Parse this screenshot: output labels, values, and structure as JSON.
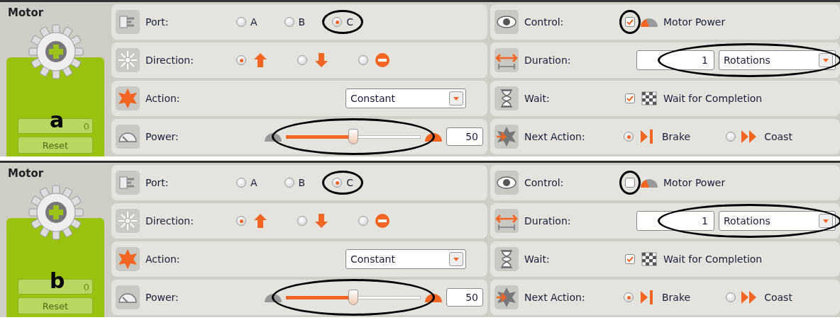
{
  "panels": [
    {
      "title": "Motor",
      "label": "a",
      "counter": "0",
      "reset": "Reset",
      "port": {
        "label": "Port:",
        "options": [
          {
            "text": "A",
            "selected": false,
            "circled": false
          },
          {
            "text": "B",
            "selected": false,
            "circled": false
          },
          {
            "text": "C",
            "selected": true,
            "circled": true
          }
        ]
      },
      "direction": {
        "label": "Direction:",
        "options": [
          {
            "kind": "forward",
            "selected": true
          },
          {
            "kind": "backward",
            "selected": false
          },
          {
            "kind": "stop",
            "selected": false
          }
        ]
      },
      "action": {
        "label": "Action:",
        "value": "Constant"
      },
      "power": {
        "label": "Power:",
        "level": 0.5,
        "value": "50",
        "circled": true
      },
      "control": {
        "label": "Control:",
        "checked": true,
        "circled": true,
        "text": "Motor Power"
      },
      "duration": {
        "label": "Duration:",
        "value": "1",
        "unit": "Rotations",
        "circled": true
      },
      "wait": {
        "label": "Wait:",
        "checked": true,
        "text": "Wait for Completion"
      },
      "next_action": {
        "label": "Next Action:",
        "options": [
          {
            "kind": "brake",
            "text": "Brake",
            "selected": true
          },
          {
            "kind": "coast",
            "text": "Coast",
            "selected": false
          }
        ]
      }
    },
    {
      "title": "Motor",
      "label": "b",
      "counter": "0",
      "reset": "Reset",
      "port": {
        "label": "Port:",
        "options": [
          {
            "text": "A",
            "selected": false,
            "circled": false
          },
          {
            "text": "B",
            "selected": false,
            "circled": false
          },
          {
            "text": "C",
            "selected": true,
            "circled": true
          }
        ]
      },
      "direction": {
        "label": "Direction:",
        "options": [
          {
            "kind": "forward",
            "selected": true
          },
          {
            "kind": "backward",
            "selected": false
          },
          {
            "kind": "stop",
            "selected": false
          }
        ]
      },
      "action": {
        "label": "Action:",
        "value": "Constant"
      },
      "power": {
        "label": "Power:",
        "level": 0.5,
        "value": "50",
        "circled": true
      },
      "control": {
        "label": "Control:",
        "checked": false,
        "circled": true,
        "text": "Motor Power"
      },
      "duration": {
        "label": "Duration:",
        "value": "1",
        "unit": "Rotations",
        "circled": true
      },
      "wait": {
        "label": "Wait:",
        "checked": true,
        "text": "Wait for Completion"
      },
      "next_action": {
        "label": "Next Action:",
        "options": [
          {
            "kind": "brake",
            "text": "Brake",
            "selected": true
          },
          {
            "kind": "coast",
            "text": "Coast",
            "selected": false
          }
        ]
      }
    }
  ]
}
